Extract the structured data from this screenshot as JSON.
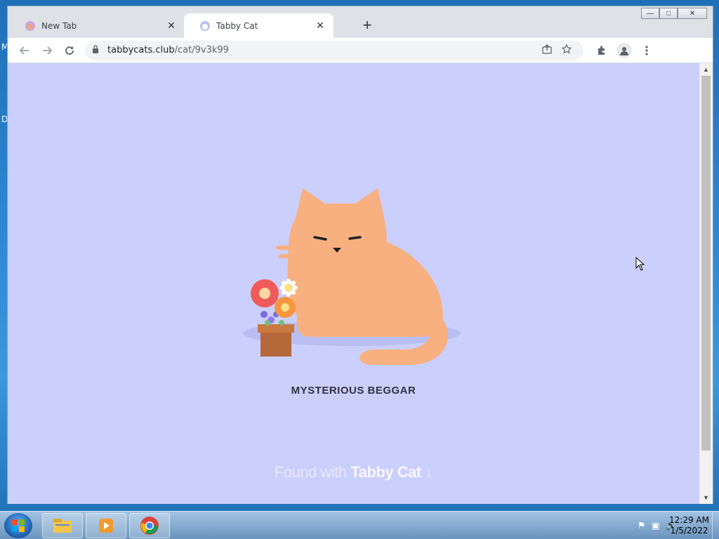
{
  "desktop": {
    "letters": [
      "M",
      "D"
    ]
  },
  "browser": {
    "tabs": [
      {
        "title": "New Tab",
        "active": false
      },
      {
        "title": "Tabby Cat",
        "active": true
      }
    ],
    "new_tab_glyph": "+",
    "close_glyph": "✕",
    "window_controls": {
      "minimize": "—",
      "maximize": "□",
      "close": "✕"
    },
    "address": {
      "host": "tabbycats.club",
      "path": "/cat/9v3k99"
    },
    "icons": [
      "back-icon",
      "forward-icon",
      "reload-icon",
      "lock-icon",
      "share-icon",
      "star-icon",
      "extensions-icon",
      "profile-icon",
      "menu-icon"
    ]
  },
  "page": {
    "cat_name": "MYSTERIOUS BEGGAR",
    "found_with": "Found with",
    "brand": "Tabby Cat",
    "arrow": "↓",
    "colors": {
      "background": "#cbcffb",
      "cat": "#f8b080",
      "pot": "#b5683a"
    }
  },
  "taskbar": {
    "apps": [
      "file-explorer-icon",
      "media-player-icon",
      "chrome-icon"
    ],
    "clock_time": "12:29 AM",
    "clock_date": "1/5/2022"
  }
}
